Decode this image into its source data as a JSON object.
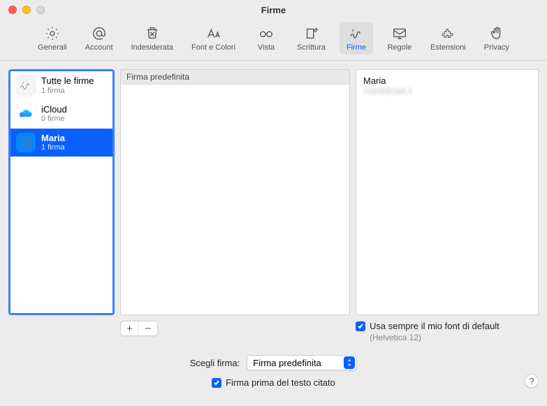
{
  "window": {
    "title": "Firme"
  },
  "toolbar": {
    "items": [
      {
        "label": "Generali"
      },
      {
        "label": "Account"
      },
      {
        "label": "Indesiderata"
      },
      {
        "label": "Font e Colori"
      },
      {
        "label": "Vista"
      },
      {
        "label": "Scrittura"
      },
      {
        "label": "Firme"
      },
      {
        "label": "Regole"
      },
      {
        "label": "Estensioni"
      },
      {
        "label": "Privacy"
      }
    ],
    "selected_index": 6
  },
  "accounts": [
    {
      "name": "Tutte le firme",
      "sub": "1 firma",
      "icon": "signature"
    },
    {
      "name": "iCloud",
      "sub": "0 firme",
      "icon": "cloud"
    },
    {
      "name": "Maria",
      "sub": "1 firma",
      "icon": "at"
    }
  ],
  "selected_account_index": 2,
  "signature_header": "Firma predefinita",
  "preview": {
    "name": "Maria",
    "sub": "mardi@iadi.il"
  },
  "buttons": {
    "add": "+",
    "remove": "−"
  },
  "checkbox_font": {
    "label": "Usa sempre il mio font di default",
    "sub": "(Helvetica 12)",
    "checked": true
  },
  "choose": {
    "label": "Scegli firma:",
    "value": "Firma predefinita"
  },
  "checkbox_before": {
    "label": "Firma prima del testo citato",
    "checked": true
  },
  "help": "?"
}
